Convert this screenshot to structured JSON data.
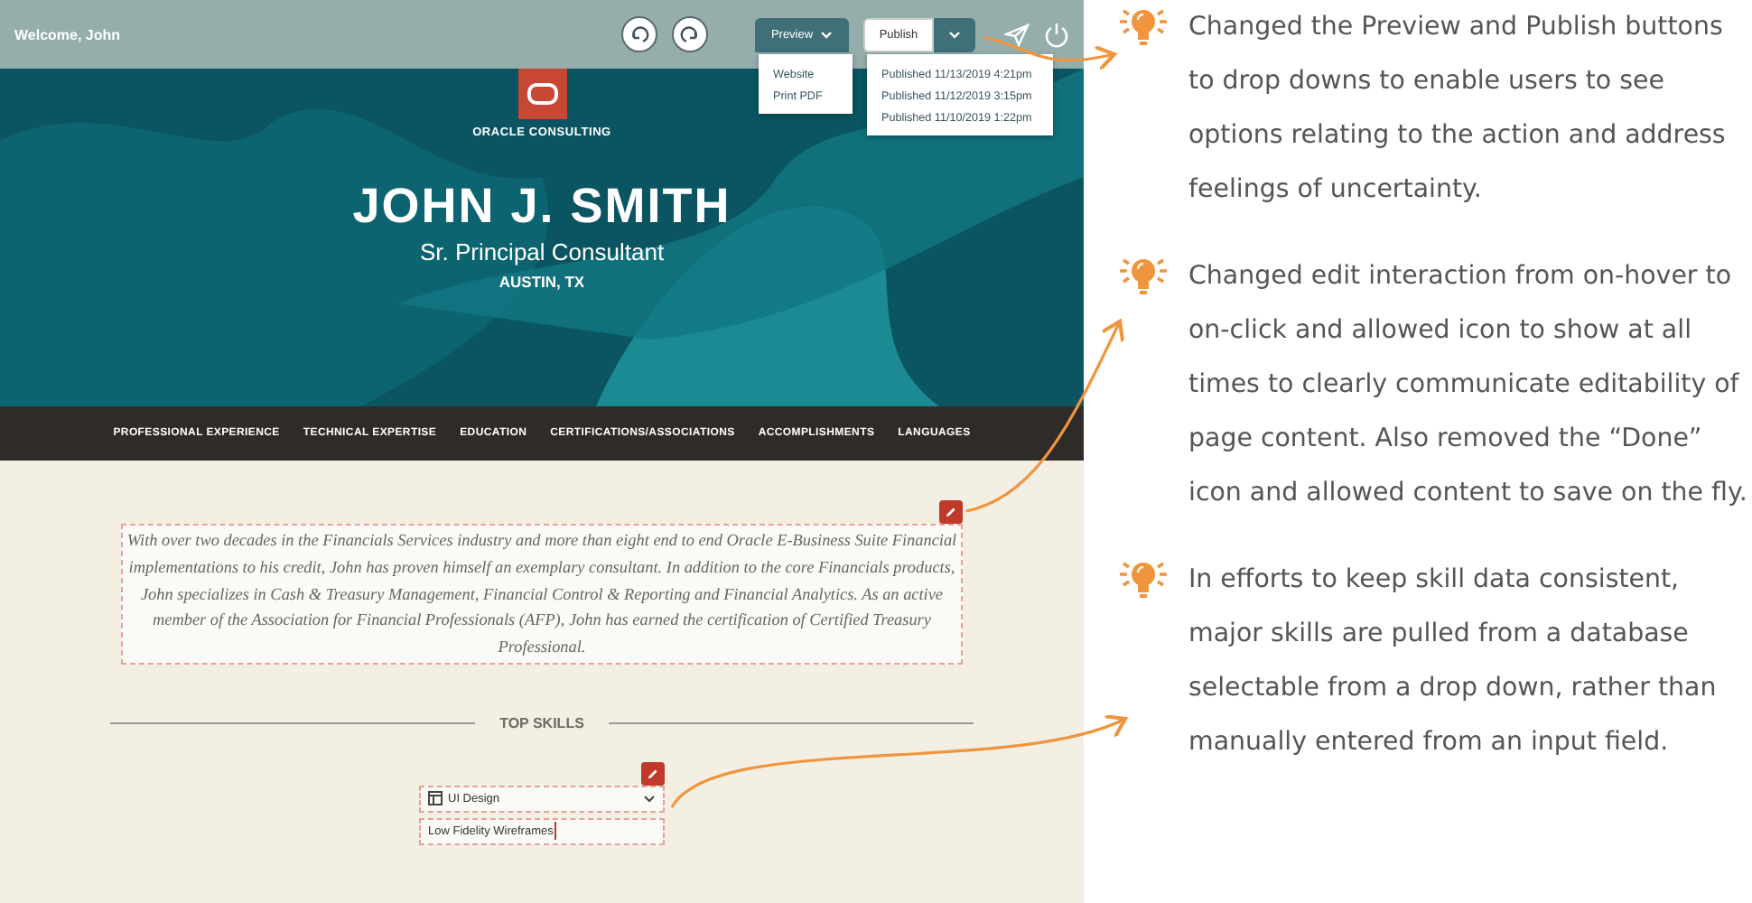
{
  "top_bar": {
    "welcome": "Welcome, John",
    "preview_button": "Preview",
    "publish_button": "Publish"
  },
  "preview_menu": [
    "Website",
    "Print PDF"
  ],
  "publish_menu": [
    "Published 11/13/2019 4:21pm",
    "Published 11/12/2019 3:15pm",
    "Published 11/10/2019 1:22pm"
  ],
  "hero": {
    "logo_caption": "ORACLE CONSULTING",
    "name": "JOHN J. SMITH",
    "title": "Sr. Principal Consultant",
    "location": "AUSTIN, TX"
  },
  "nav": [
    "PROFESSIONAL EXPERIENCE",
    "TECHNICAL EXPERTISE",
    "EDUCATION",
    "CERTIFICATIONS/ASSOCIATIONS",
    "ACCOMPLISHMENTS",
    "LANGUAGES"
  ],
  "summary": {
    "text": "With over two decades in the Financials Services industry and more than eight end to end Oracle E-Business Suite Financial implementations to his credit, John has proven himself an exemplary consultant. In addition to the core Financials products, John specializes in Cash & Treasury Management, Financial Control & Reporting and Financial Analytics. As an active member of the Association for Financial Professionals (AFP), John has earned the certification of Certified Treasury Professional."
  },
  "top_skills": {
    "heading": "TOP SKILLS",
    "skill": "UI Design",
    "detail": "Low Fidelity Wireframes"
  },
  "annotations": [
    "Changed the Preview and Publish buttons to drop downs to enable users to see options relating to the action and address feelings of uncertainty.",
    "Changed edit interaction from on-hover to on-click and allowed icon to show at all times to clearly communicate editability of page content. Also removed the “Done” icon and allowed content to save on the fly.",
    "In efforts to keep skill data consistent, major skills are pulled from a database selectable from a drop down, rather than manually entered from an input field."
  ]
}
